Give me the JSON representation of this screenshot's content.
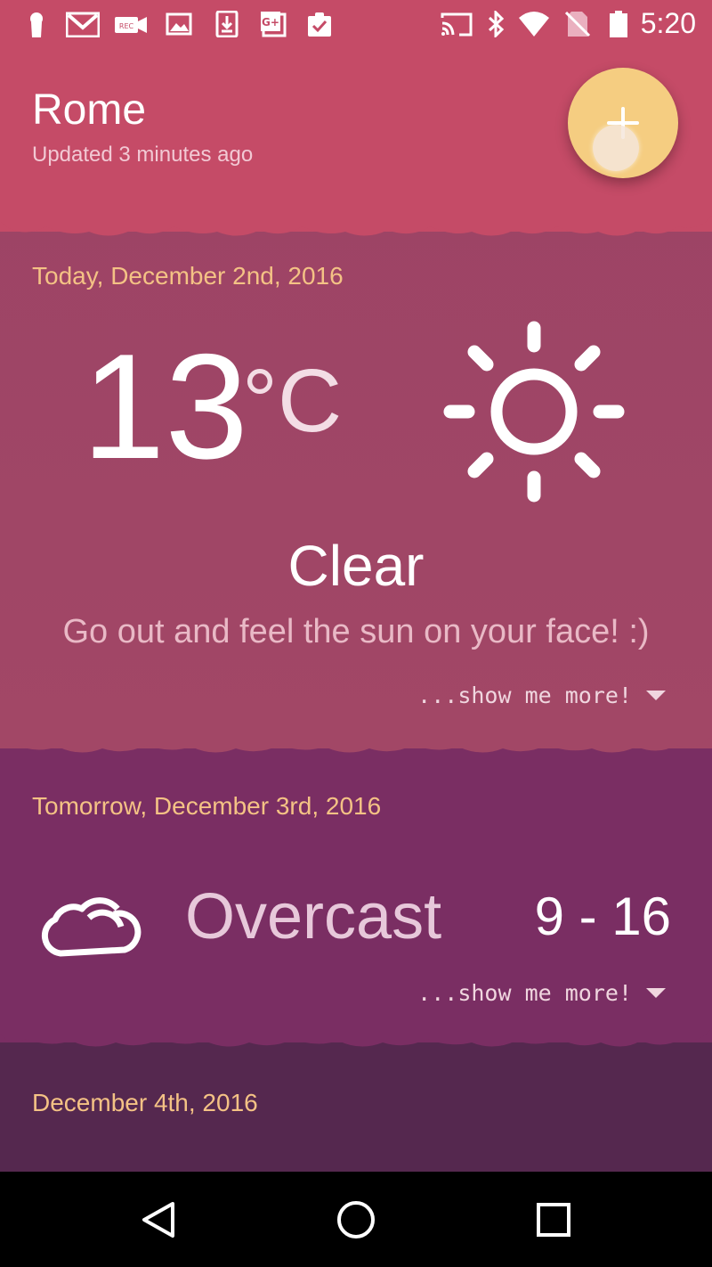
{
  "status_bar": {
    "time": "5:20",
    "left_icons": [
      "keyhole-icon",
      "gmail-icon",
      "screen-record-icon",
      "image-icon",
      "download-icon",
      "google-plus-icon",
      "clipboard-check-icon"
    ],
    "right_icons": [
      "cast-icon",
      "bluetooth-icon",
      "wifi-icon",
      "no-sim-icon",
      "battery-icon"
    ]
  },
  "header": {
    "city": "Rome",
    "updated": "Updated 3 minutes ago",
    "add_button_icon": "plus-icon"
  },
  "today": {
    "date_label": "Today, December 2nd, 2016",
    "temperature": "13",
    "unit": "°C",
    "icon": "sun-icon",
    "condition": "Clear",
    "tagline": "Go out and feel the sun on your face! :)",
    "more_label": "...show me more!"
  },
  "tomorrow": {
    "date_label": "Tomorrow, December 3rd, 2016",
    "icon": "cloud-icon",
    "condition": "Overcast",
    "range": "9 - 16",
    "more_label": "...show me more!"
  },
  "day3": {
    "date_label": "December 4th, 2016"
  },
  "nav_bar": {
    "buttons": [
      "back-icon",
      "home-icon",
      "recents-icon"
    ]
  },
  "colors": {
    "header_bg": "#c54b67",
    "today_bg": "#9b4365",
    "tomorrow_bg": "#7a2e63",
    "day3_bg": "#55284f",
    "date_label": "#f4c285",
    "fab": "#f5cd81"
  }
}
